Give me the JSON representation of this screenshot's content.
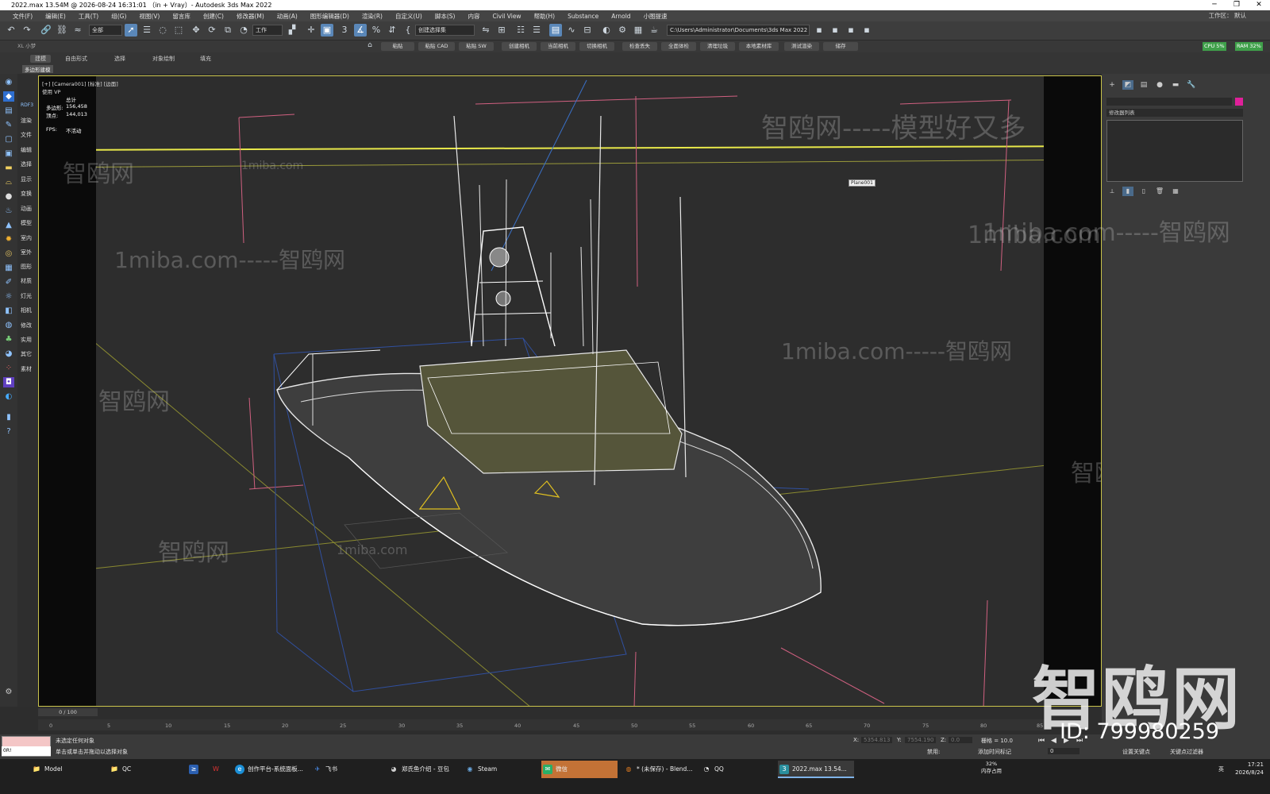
{
  "window": {
    "title": "2022.max 13.54M @ 2026-08-24 16:31:01 （in + Vray）- Autodesk 3ds Max 2022",
    "controls": [
      "─",
      "❐",
      "✕"
    ]
  },
  "menubar": {
    "items": [
      "文件(F)",
      "编辑(E)",
      "工具(T)",
      "组(G)",
      "视图(V)",
      "留言库",
      "创建(C)",
      "修改器(M)",
      "动画(A)",
      "图形编辑器(D)",
      "渲染(R)",
      "自定义(U)",
      "脚本(S)",
      "内容",
      "Civil View",
      "帮助(H)",
      "Substance",
      "Arnold",
      "小图提速"
    ],
    "workspace": "工作区： 默认"
  },
  "toolbar": {
    "filter": "全部",
    "coord": "工作",
    "selection_set": "创建选择集",
    "path": "C:\\Users\\Administrator\\Documents\\3ds Max 2022",
    "cpu_label": "CPU 5%",
    "ram_label": "RAM 32%"
  },
  "toolbar2": {
    "left_label": "XL 小梦",
    "pills": [
      "粘贴",
      "粘贴 CAD",
      "粘贴 SW",
      "创建相机",
      "当前相机",
      "切换相机",
      "检查丢失",
      "全面体检",
      "清理垃圾",
      "本地素材库",
      "测试渲染",
      "储存"
    ]
  },
  "ribbon": {
    "tabs": [
      "建模",
      "自由形式",
      "选择",
      "对象绘制",
      "填充"
    ],
    "sub": "多边形建模"
  },
  "leftpanel": {
    "labels": [
      "RDF3",
      "渲染",
      "文件",
      "编辑",
      "选择",
      "显示",
      "变换",
      "动画",
      "模型",
      "室内",
      "室外",
      "图形",
      "材质",
      "灯光",
      "相机",
      "修改",
      "实用",
      "其它",
      "素材"
    ]
  },
  "viewport": {
    "label": "[+] [Camera001] [标准] [边面]",
    "sub": "使用 VP",
    "stats": {
      "header": "总计",
      "poly_label": "多边形:",
      "poly_value": "156,458",
      "vert_label": "顶点:",
      "vert_value": "144,013",
      "fps_label": "FPS:",
      "fps_value": "不活动"
    },
    "object_label": "Plane001"
  },
  "cmdpanel": {
    "modifier_list": "修改器列表"
  },
  "watermarks": {
    "short": "智鸥网",
    "long": "智鸥网-----模型好又多",
    "site": "1miba.com",
    "site_line": "1miba.com-----智鸥网",
    "big": "智鸥网",
    "id": "ID: 799980259"
  },
  "timeline": {
    "frame": "0 / 100",
    "ticks": [
      "0",
      "5",
      "10",
      "15",
      "20",
      "25",
      "30",
      "35",
      "40",
      "45",
      "50",
      "55",
      "60",
      "65",
      "70",
      "75",
      "80",
      "85"
    ]
  },
  "status": {
    "line1": "未选定任何对象",
    "line2": "单击或单击并拖动以选择对象",
    "maxscript": "0R!",
    "x_label": "X:",
    "x_value": "5354.813",
    "y_label": "Y:",
    "y_value": "7554.190",
    "z_label": "Z:",
    "z_value": "0.0",
    "grid": "栅格 = 10.0",
    "addtime": "添加时间标记",
    "setkey": "设置关键点",
    "keyfilter": "关键点过滤器",
    "disable": "禁用:",
    "spinner": "0"
  },
  "taskbar": {
    "items": [
      {
        "label": "Model",
        "icon": "📁",
        "color": "#e8b84a"
      },
      {
        "label": "QC",
        "icon": "📁",
        "color": "#e8b84a"
      },
      {
        "label": "",
        "icon": "≥",
        "color": "#2b5fb0"
      },
      {
        "label": "",
        "icon": "W",
        "color": "#d33"
      },
      {
        "label": "创作平台-系统面板...",
        "icon": "e",
        "color": "#1b8fd6"
      },
      {
        "label": "飞书",
        "icon": "✈",
        "color": "#2e6fd8"
      },
      {
        "label": "郑氏鱼介绍 - 豆包",
        "icon": "◕",
        "color": "#777"
      },
      {
        "label": "Steam",
        "icon": "◉",
        "color": "#1b3a5c"
      },
      {
        "label": "微信",
        "icon": "✉",
        "color": "#2aae67"
      },
      {
        "label": "* (未保存) - Blend...",
        "icon": "◍",
        "color": "#e07b20"
      },
      {
        "label": "QQ",
        "icon": "◔",
        "color": "#222"
      },
      {
        "label": "2022.max  13.54...",
        "icon": "3",
        "color": "#2a8f9e"
      }
    ],
    "memory_pct": "32%",
    "memory_label": "内存占用",
    "lang": "英",
    "time": "17:21",
    "date": "2026/8/24"
  }
}
